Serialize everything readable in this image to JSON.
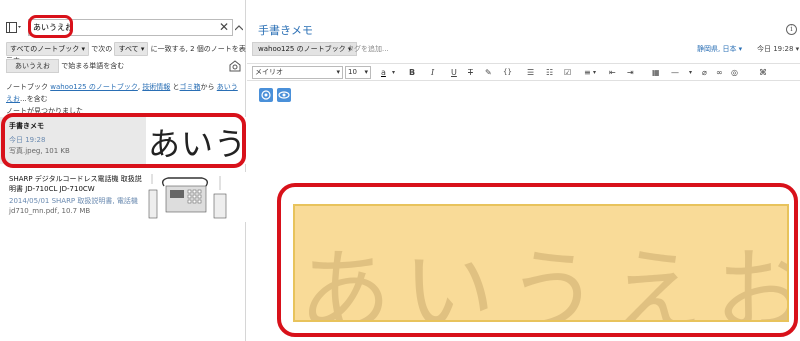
{
  "search": {
    "value": "あいうえお",
    "clear": "✕"
  },
  "filter": {
    "notebook_label": "すべてのノートブック",
    "prefix": "で次の",
    "all_label": "すべて",
    "suffix": "に一致する, 2 個のノートを表示中:",
    "term": "あいうえお",
    "term_suffix": "で始まる単語を含む"
  },
  "found": {
    "line1_prefix": "ノートブック",
    "notebook_link": "wahoo125 のノートブック",
    "sep1": ",",
    "link2": "技術情報",
    "sep2": "と",
    "link3": "ゴミ箱",
    "mid": "から",
    "term_link": "あいうえお",
    "end1": "を含む",
    "line2": "ノートが見つかりました"
  },
  "notes": [
    {
      "title": "手書きメモ",
      "date": "今日 19:28",
      "meta": "写真.jpeg,  101 KB",
      "thumb_text": "あいうえお"
    },
    {
      "title": "SHARP デジタルコードレス電話機 取扱説明書 JD-710CL JD-710CW",
      "date": "2014/05/01  SHARP 取扱説明書, 電話機",
      "meta": "jd710_mn.pdf,  10.7 MB"
    }
  ],
  "editor": {
    "title": "手書きメモ",
    "notebook": "wahoo125 のノートブック",
    "tag_placeholder": "タグを追加...",
    "location": "静岡県, 日本",
    "date": "今日 19:28",
    "font": "メイリオ",
    "size": "10",
    "content_text": "あいうえお"
  },
  "colors": {
    "accent": "#2a6fb5",
    "highlight_ring": "#d8111a",
    "image_bg": "#f9db98"
  }
}
